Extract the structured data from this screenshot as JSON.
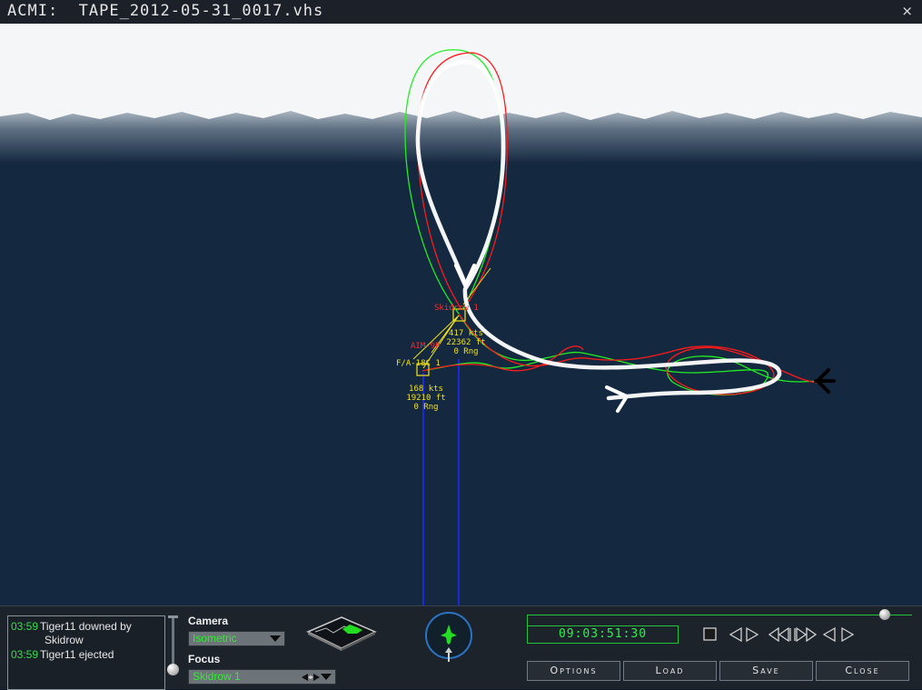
{
  "window": {
    "title": "ACMI:  TAPE_2012-05-31_0017.vhs",
    "close_glyph": "×"
  },
  "viewport": {
    "labels": {
      "skidrow_name": "Skidrow 1",
      "skidrow_speed": "417 kts",
      "skidrow_alt": "22362 ft",
      "skidrow_rng": "0 Rng",
      "missile_name": "AIM-9P",
      "bandit_name": "F/A-18C 1",
      "bandit_speed": "168 kts",
      "bandit_alt": "19210 ft",
      "bandit_rng": "0 Rng"
    },
    "colors": {
      "sky": "#f4f6f8",
      "horizon": "#8796a5",
      "ground": "#14283f",
      "track_red": "#ff1a1a",
      "track_green": "#22ee22",
      "track_white": "#ffffff",
      "altitude_line": "#1a2ad8",
      "label_yellow": "#f2e21a"
    }
  },
  "event_log": {
    "entries": [
      {
        "time": "03:59",
        "text": "Tiger11 downed by",
        "cont": "Skidrow"
      },
      {
        "time": "03:59",
        "text": "Tiger11 ejected",
        "cont": ""
      }
    ]
  },
  "camera": {
    "label": "Camera",
    "value": "Isometric"
  },
  "focus": {
    "label": "Focus",
    "value": "Skidrow 1"
  },
  "icons": {
    "terrain": "terrain-map-icon",
    "compass": "compass-heading-icon",
    "stop": "stop-icon",
    "step_back": "step-back-icon",
    "step_forward": "step-forward-icon",
    "rewind": "rewind-icon",
    "fast_forward": "fast-forward-icon",
    "play_reverse": "play-reverse-icon",
    "play": "play-icon"
  },
  "playback": {
    "time": "09:03:51:30",
    "position": 0.93
  },
  "buttons": {
    "options": "Options",
    "load": "Load",
    "save": "Save",
    "close": "Close"
  }
}
